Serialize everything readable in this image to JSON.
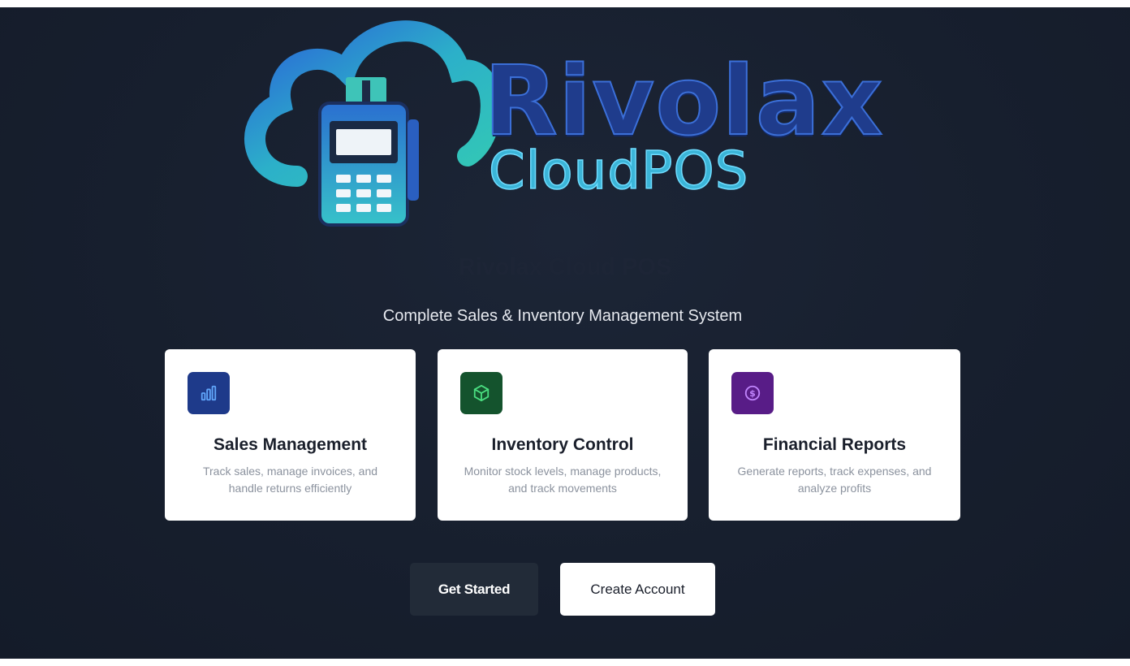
{
  "brand": {
    "name": "Rivolax",
    "product": "CloudPOS"
  },
  "hero": {
    "title": "Rivolax Cloud POS",
    "subtitle": "Complete Sales & Inventory Management System"
  },
  "features": [
    {
      "icon": "bar-chart-icon",
      "icon_bg": "#1e3a8a",
      "icon_color": "#60a5fa",
      "title": "Sales Management",
      "description": "Track sales, manage invoices, and handle returns efficiently"
    },
    {
      "icon": "package-icon",
      "icon_bg": "#14532d",
      "icon_color": "#4ade80",
      "title": "Inventory Control",
      "description": "Monitor stock levels, manage products, and track movements"
    },
    {
      "icon": "dollar-circle-icon",
      "icon_bg": "#581c87",
      "icon_color": "#c084fc",
      "title": "Financial Reports",
      "description": "Generate reports, track expenses, and analyze profits"
    }
  ],
  "actions": {
    "get_started": "Get Started",
    "create_account": "Create Account"
  },
  "colors": {
    "background": "#171f2e",
    "card": "#ffffff",
    "primary_button": "#222b38"
  }
}
